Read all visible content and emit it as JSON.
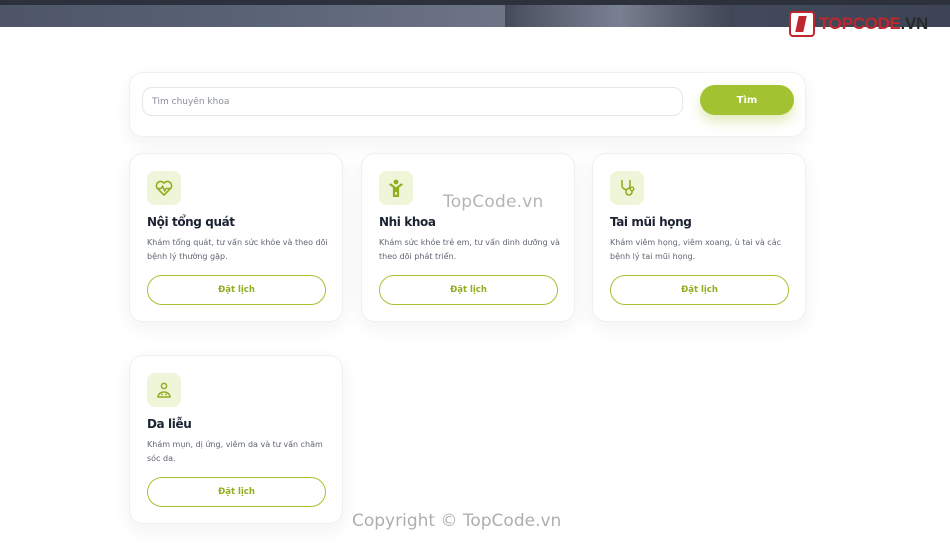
{
  "brand": {
    "logo_text": "TOPCODE",
    "logo_suffix": ".VN"
  },
  "search": {
    "placeholder": "Tìm chuyên khoa",
    "value": "",
    "button_label": "Tìm"
  },
  "specialties": [
    {
      "icon": "heart-pulse-icon",
      "title": "Nội tổng quát",
      "description": "Khám tổng quát, tư vấn sức khỏe và theo dõi bệnh lý thường gặp.",
      "button_label": "Đặt lịch"
    },
    {
      "icon": "child-icon",
      "title": "Nhi khoa",
      "description": "Khám sức khỏe trẻ em, tư vấn dinh dưỡng và theo dõi phát triển.",
      "button_label": "Đặt lịch"
    },
    {
      "icon": "stethoscope-icon",
      "title": "Tai mũi họng",
      "description": "Khám viêm họng, viêm xoang, ù tai và các bệnh lý tai mũi họng.",
      "button_label": "Đặt lịch"
    },
    {
      "icon": "skin-care-icon",
      "title": "Da liễu",
      "description": "Khám mụn, dị ứng, viêm da và tư vấn chăm sóc da.",
      "button_label": "Đặt lịch"
    }
  ],
  "watermarks": {
    "center": "TopCode.vn",
    "bottom": "Copyright © TopCode.vn"
  },
  "colors": {
    "accent": "#a3c232",
    "icon_bg": "#eef5d8",
    "title": "#1c2333",
    "text": "#5f6672"
  }
}
